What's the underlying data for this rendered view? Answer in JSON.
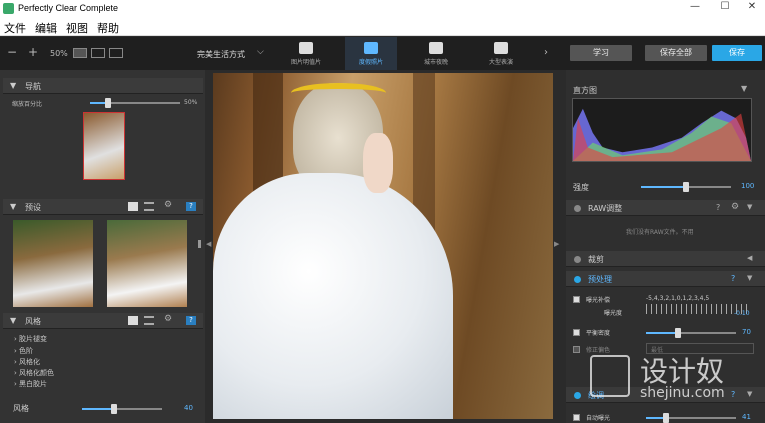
{
  "window": {
    "title": "Perfectly Clear Complete",
    "minimize": "—",
    "maximize": "☐",
    "close": "✕"
  },
  "menu": [
    "文件",
    "编辑",
    "视图",
    "帮助"
  ],
  "toolbar": {
    "zoom_out": "−",
    "zoom_in": "+",
    "zoom_level": "50%",
    "preset_group": "完美生活方式",
    "presets": [
      {
        "label": "图片明值片",
        "icon": "image-icon",
        "active": false
      },
      {
        "label": "度假照片",
        "icon": "palm-tree-icon",
        "active": true
      },
      {
        "label": "城市夜晚",
        "icon": "city-icon",
        "active": false
      },
      {
        "label": "大型表演",
        "icon": "stage-icon",
        "active": false
      }
    ],
    "next_arrow": "›",
    "learn_label": "学习",
    "save_all_label": "保存全部",
    "save_label": "保存"
  },
  "left": {
    "nav": {
      "title": "导航",
      "zoom_label": "缩放百分比",
      "zoom_value": "50%",
      "zoom_fraction": 0.2
    },
    "presets": {
      "title": "预设"
    },
    "looks": {
      "title": "风格",
      "items": [
        "胶片褪变",
        "色阶",
        "风格化",
        "风格化颜色",
        "黑白胶片"
      ],
      "strength_label": "风格",
      "strength_value": "40",
      "strength_fraction": 0.4
    }
  },
  "right": {
    "histogram": {
      "title": "直方图"
    },
    "strength": {
      "label": "强度",
      "value": "100",
      "fraction": 0.5
    },
    "raw": {
      "title": "RAW调整",
      "note": "我们没有RAW文件。不用"
    },
    "crop": {
      "title": "裁剪"
    },
    "preprocess": {
      "title": "预处理",
      "exposure_label": "曝光补偿",
      "exposure_scale": "-5,4,3,2,1,0,1,2,3,4,5",
      "exposure_sub": "曝光度",
      "exposure_value": "-0.10",
      "balance_label": "平衡密度",
      "balance_value": "70",
      "balance_fraction": 0.35,
      "fix_label": "修正偏色",
      "fix_option": "最低"
    },
    "correct": {
      "title": "绘调",
      "auto_exposure_label": "自动曝光",
      "auto_exposure_value": "41",
      "auto_exposure_fraction": 0.22
    }
  },
  "watermark": {
    "cn": "设计奴",
    "url": "shejinu.com"
  }
}
